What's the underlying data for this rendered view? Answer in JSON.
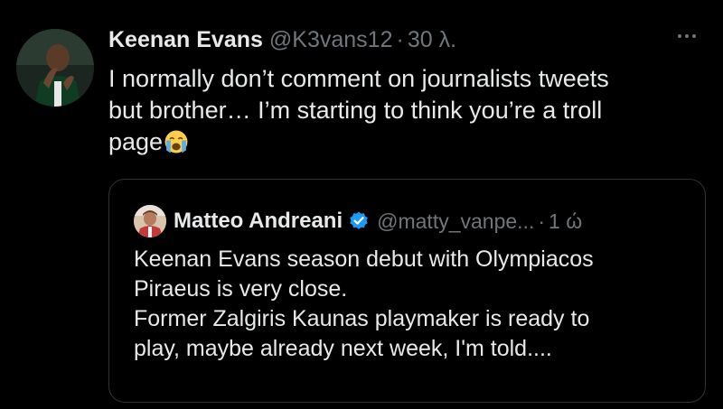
{
  "tweet": {
    "author_name": "Keenan Evans",
    "handle": "@K3vans12",
    "separator": "·",
    "time": "30 λ.",
    "text_lines": [
      "I normally don’t comment on journalists tweets",
      "but brother… I’m starting to think you’re a troll",
      "page"
    ],
    "emoji": "loudly-crying-face"
  },
  "quoted_tweet": {
    "author_name": "Matteo Andreani",
    "verified": true,
    "handle": "@matty_vanpe...",
    "separator": "·",
    "time": "1 ώ",
    "text_lines": [
      "Keenan Evans season debut with Olympiacos",
      "Piraeus is very close.",
      "Former Zalgiris Kaunas playmaker is ready to",
      "play, maybe already next week, I'm told...."
    ]
  },
  "colors": {
    "background": "#000000",
    "text_primary": "#e7e9ea",
    "text_secondary": "#71767b",
    "border": "#2f3336",
    "verified_blue": "#1d9bf0"
  },
  "icons": {
    "more": "more-icon",
    "verified": "verified-badge-icon"
  }
}
